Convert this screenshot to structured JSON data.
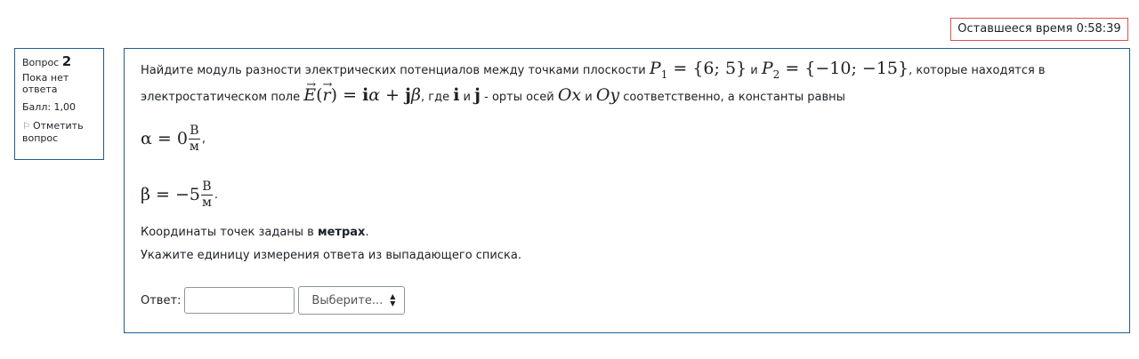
{
  "timer": {
    "label": "Оставшееся время",
    "value": "0:58:39"
  },
  "info": {
    "question_label": "Вопрос",
    "question_number": "2",
    "state": "Пока нет ответа",
    "grade": "Балл: 1,00",
    "flag_label": "Отметить вопрос"
  },
  "question": {
    "line1_a": "Найдите модуль разности электрических потенциалов между точками плоскости ",
    "p1_sym": "P",
    "p1_sub": "1",
    "p1_val": " = {6;  5}",
    "and1": " и ",
    "p2_sym": "P",
    "p2_sub": "2",
    "p2_val": " = {−10;  −15}",
    "line1_b": ", которые находятся в",
    "line2_a": "электростатическом поле ",
    "field_expr_1": "E",
    "field_expr_2": "(",
    "field_expr_r": "r",
    "field_expr_3": ") = ",
    "field_i": "i",
    "field_alpha": "α",
    "field_plus": " + ",
    "field_j": "j",
    "field_beta": "β",
    "line2_b": ", где ",
    "vec_i": "i",
    "and2": " и ",
    "vec_j": "j",
    "line2_c": " - орты осей ",
    "ox": "Ox",
    "and3": " и ",
    "oy": "Oy",
    "line2_d": " соответственно, а константы равны",
    "alpha_lhs": "α = 0",
    "alpha_unit_num": "В",
    "alpha_unit_den": "м",
    "alpha_tail": ",",
    "beta_lhs": "β = −5",
    "beta_unit_num": "В",
    "beta_unit_den": "м",
    "beta_tail": ".",
    "coords_a": "Координаты точек заданы в ",
    "coords_b": "метрах",
    "coords_c": ".",
    "unit_hint": "Укажите единицу измерения ответа из выпадающего списка."
  },
  "answer": {
    "label": "Ответ:",
    "value": "",
    "select_placeholder": "Выберите..."
  }
}
